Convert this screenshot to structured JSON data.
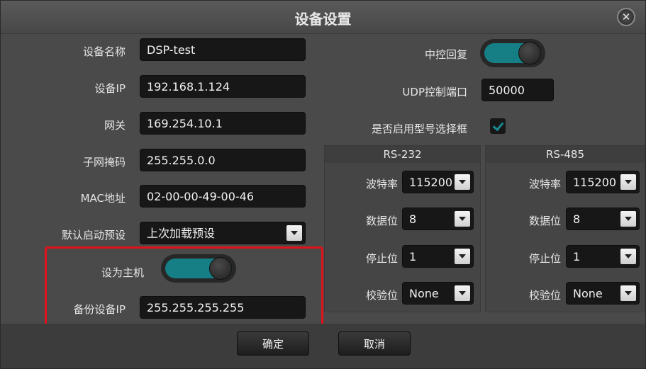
{
  "dialog": {
    "title": "设备设置",
    "close_glyph": "✕"
  },
  "device": {
    "name_label": "设备名称",
    "name_value": "DSP-test",
    "ip_label": "设备IP",
    "ip_value": "192.168.1.124",
    "gateway_label": "网关",
    "gateway_value": "169.254.10.1",
    "subnet_label": "子网掩码",
    "subnet_value": "255.255.0.0",
    "mac_label": "MAC地址",
    "mac_value": "02-00-00-49-00-46",
    "default_preset_label": "默认启动预设",
    "default_preset_value": "上次加载预设",
    "master_label": "设为主机",
    "master_on": true,
    "backup_ip_label": "备份设备IP",
    "backup_ip_value": "255.255.255.255"
  },
  "control": {
    "feedback_label": "中控回复",
    "feedback_on": true,
    "udp_port_label": "UDP控制端口",
    "udp_port_value": "50000",
    "model_select_label": "是否启用型号选择框",
    "model_select_checked": true
  },
  "rs232": {
    "title": "RS-232",
    "baud_label": "波特率",
    "baud_value": "115200",
    "databits_label": "数据位",
    "databits_value": "8",
    "stopbits_label": "停止位",
    "stopbits_value": "1",
    "parity_label": "校验位",
    "parity_value": "None"
  },
  "rs485": {
    "title": "RS-485",
    "baud_label": "波特率",
    "baud_value": "115200",
    "databits_label": "数据位",
    "databits_value": "8",
    "stopbits_label": "停止位",
    "stopbits_value": "1",
    "parity_label": "校验位",
    "parity_value": "None"
  },
  "buttons": {
    "ok_label": "确定",
    "cancel_label": "取消"
  },
  "colors": {
    "accent": "#167f85",
    "highlight_box": "#e0121a"
  }
}
